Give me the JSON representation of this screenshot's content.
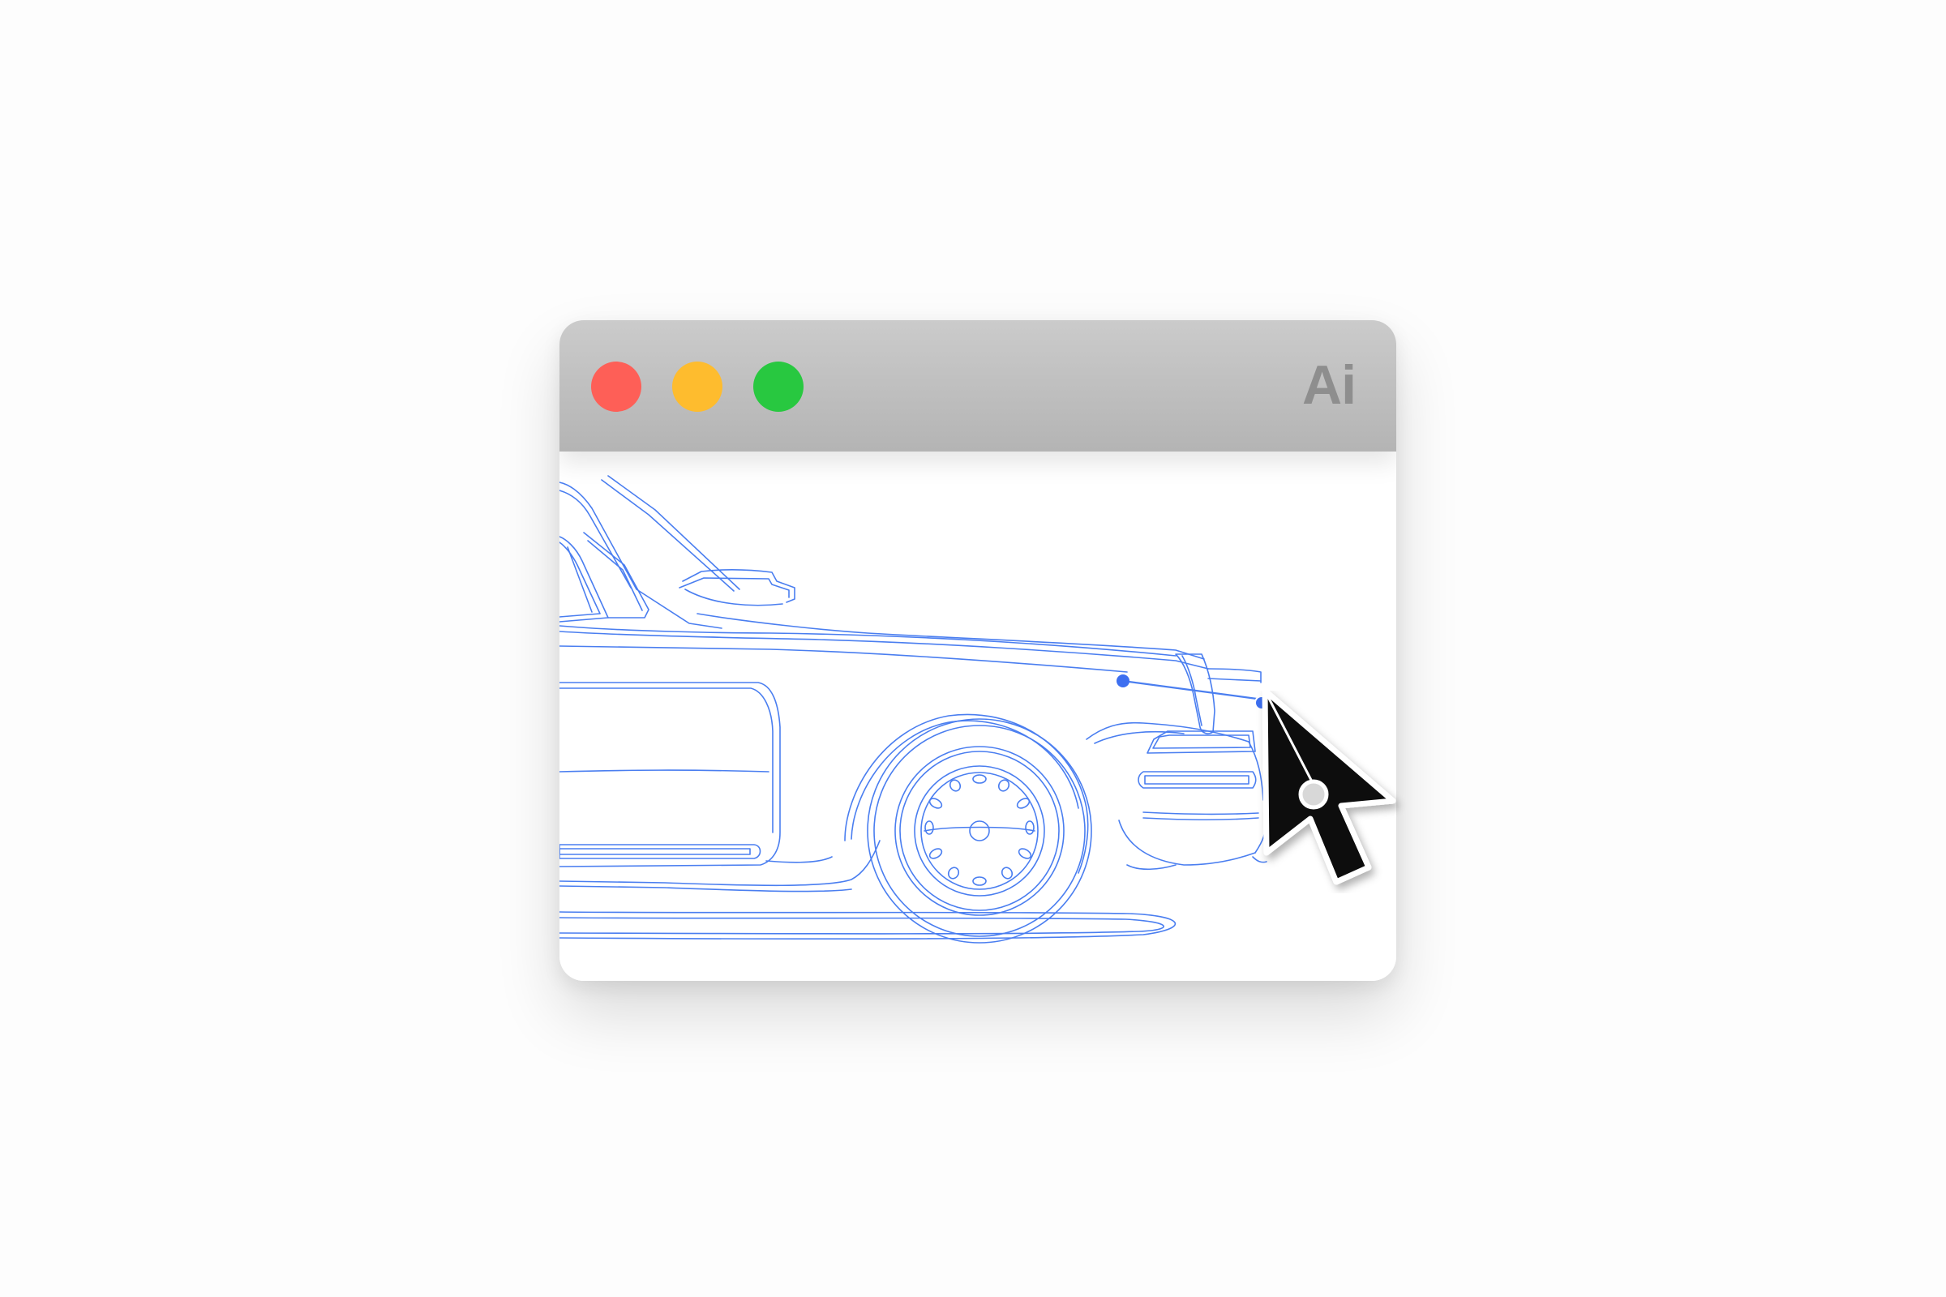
{
  "window": {
    "app_badge": "Ai",
    "controls": {
      "close": "close-button",
      "minimize": "minimize-button",
      "zoom": "zoom-button"
    },
    "colors": {
      "close": "#fe5f57",
      "minimize": "#febc2e",
      "zoom": "#28c840",
      "titlebar": "#bdbdbd",
      "artwork_stroke": "#4a7ef0"
    }
  },
  "canvas": {
    "artwork": "car-line-drawing",
    "tool": "direct-selection-cursor-icon"
  }
}
